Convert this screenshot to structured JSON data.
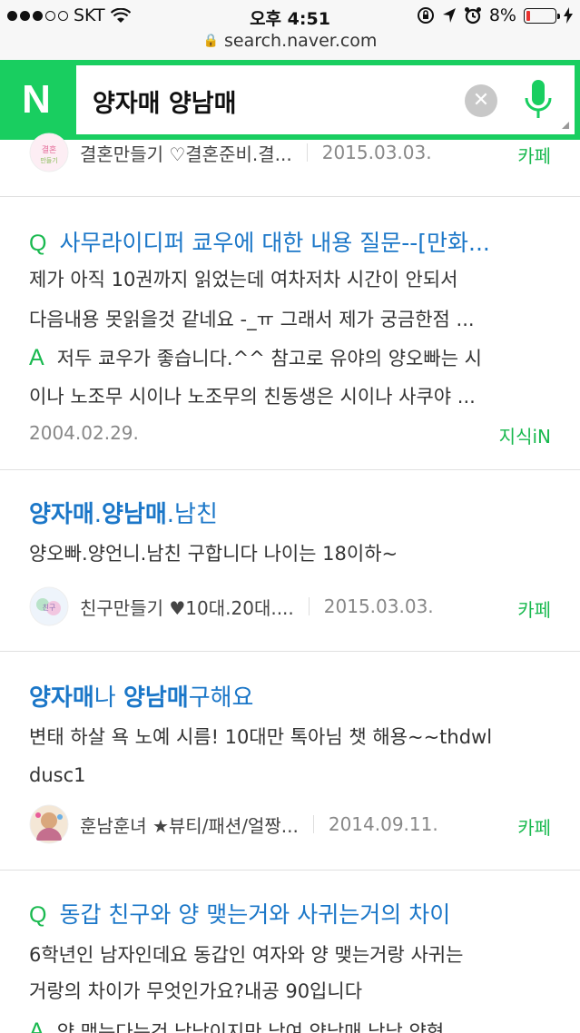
{
  "status": {
    "carrier": "SKT",
    "time": "오후 4:51",
    "battery": "8%",
    "battery_level": 0.08
  },
  "url": "search.naver.com",
  "search": {
    "logo": "N",
    "query": "양자매 양남매"
  },
  "results": [
    {
      "source": "결혼만들기 ♡결혼준비.결...",
      "date": "2015.03.03.",
      "tag": "카페"
    },
    {
      "question": "사무라이디퍼 쿄우에 대한 내용 질문--[만화...",
      "q_line1": "제가 아직 10권까지 읽었는데 여차저차 시간이 안되서",
      "q_line2": "다음내용 못읽을것 같네요 -_ㅠ 그래서 제가 궁금한점 ...",
      "a_line1": "저두 쿄우가 좋습니다.^^ 참고로 유야의 양오빠는 시",
      "a_line2": "이나 노조무 시이나 노조무의 친동생은 시이나 사쿠야 ...",
      "date": "2004.02.29.",
      "tag": "지식iN"
    },
    {
      "title_a": "양자매",
      "title_dot": ".",
      "title_b": "양남매",
      "title_rest": ".남친",
      "body": "양오빠.양언니.남친 구합니다 나이는 18이하~",
      "source": "친구만들기 ♥10대.20대....",
      "date": "2015.03.03.",
      "tag": "카페"
    },
    {
      "title_a": "양자매",
      "title_mid": "나 ",
      "title_b": "양남매",
      "title_rest": "구해요",
      "body1": "변태 하살 욕 노예 시름! 10대만 톡아님 챗 해용~~thdwl",
      "body2": "dusc1",
      "source": "훈남훈녀 ★뷰티/패션/얼짱...",
      "date": "2014.09.11.",
      "tag": "카페"
    },
    {
      "question": "동갑 친구와 양 맺는거와 사귀는거의 차이",
      "q_line1": "6학년인 남자인데요 동갑인 여자와 양 맺는거랑 사귀는",
      "q_line2": "거랑의 차이가 무엇인가요?내공 90입니다",
      "a_line1": "양 맺는다는건 남남이지만 남여 양남매 남남 양형..."
    }
  ],
  "colors": {
    "brand": "#19ce60",
    "link": "#1b77c8",
    "tag": "#19b94f"
  }
}
